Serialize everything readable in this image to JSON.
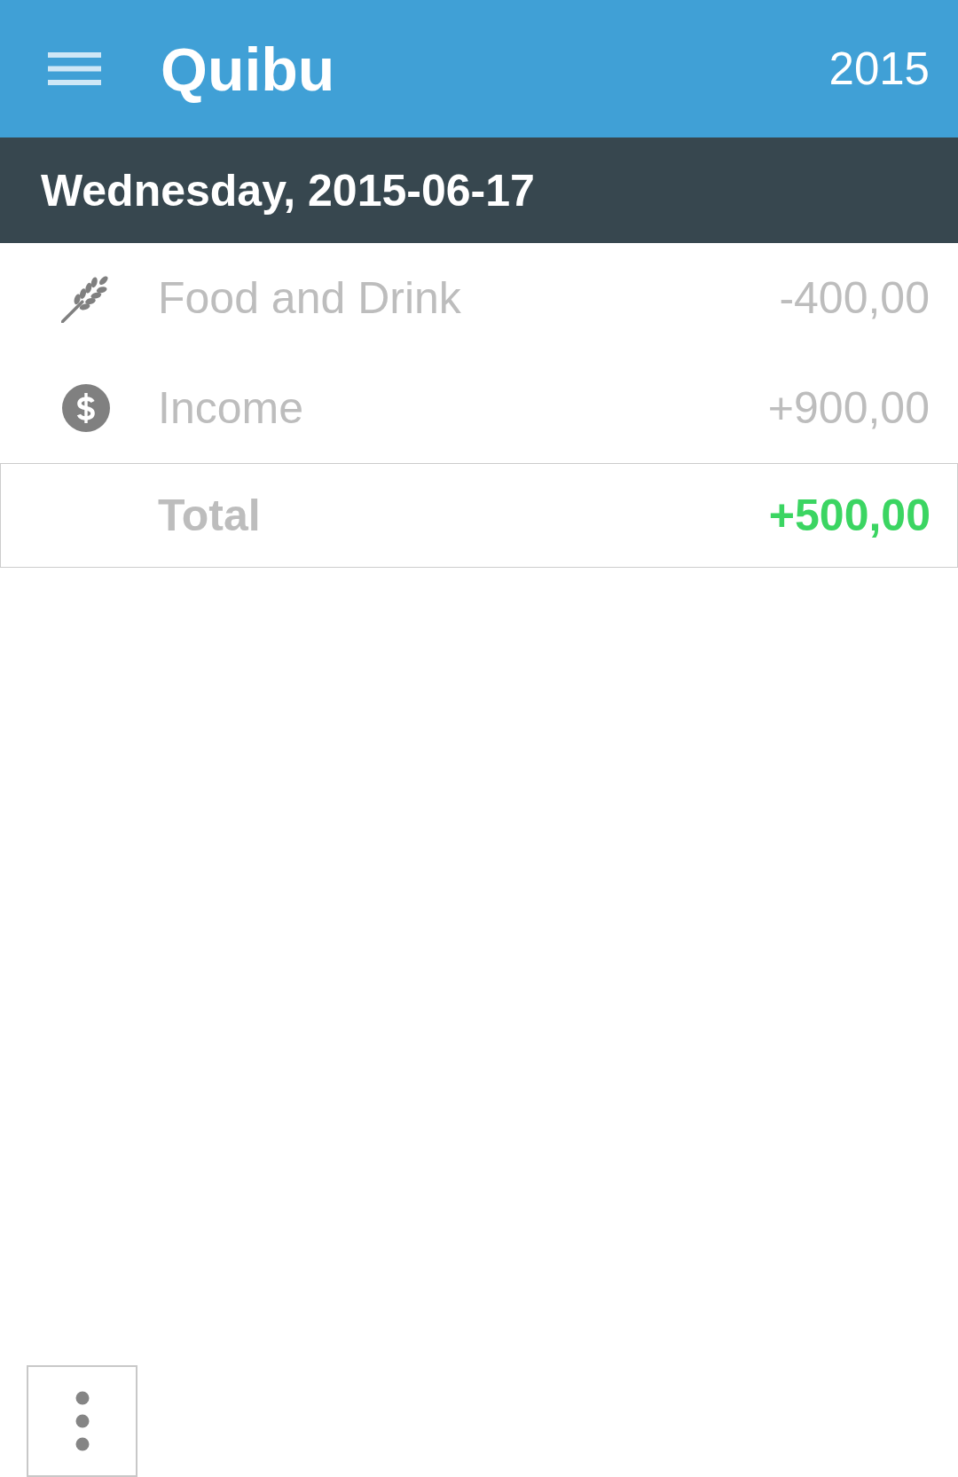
{
  "app_bar": {
    "title": "Quibu",
    "year": "2015"
  },
  "date_header": {
    "label": "Wednesday, 2015-06-17"
  },
  "entries": [
    {
      "kind": "food",
      "category": "Food and Drink",
      "amount": "-400,00"
    },
    {
      "kind": "income",
      "category": "Income",
      "amount": "+900,00"
    }
  ],
  "total": {
    "label": "Total",
    "amount": "+500,00"
  }
}
